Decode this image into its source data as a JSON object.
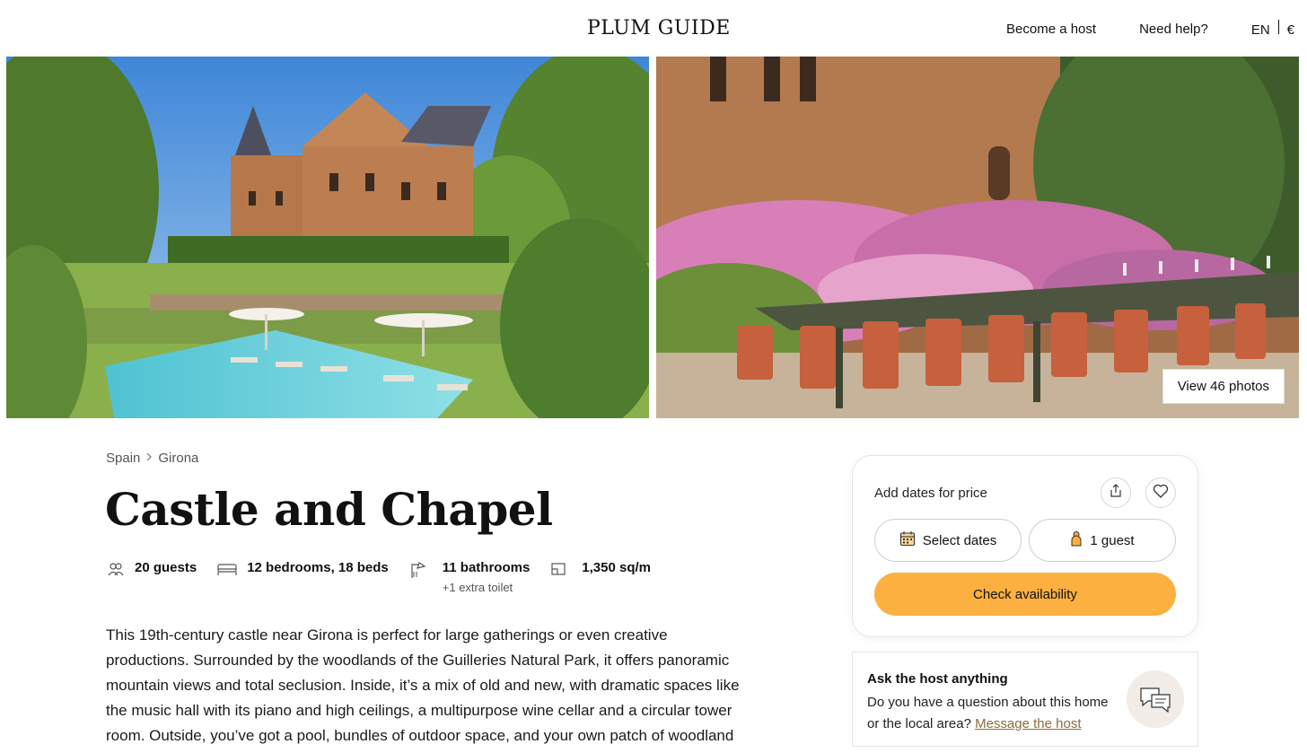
{
  "header": {
    "logo": "PLUM GUIDE",
    "become_host": "Become a host",
    "need_help": "Need help?",
    "language": "EN",
    "currency": "€"
  },
  "gallery": {
    "view_photos": "View 46 photos"
  },
  "breadcrumb": {
    "country": "Spain",
    "city": "Girona"
  },
  "listing": {
    "title": "Castle and Chapel",
    "guests": "20 guests",
    "bedrooms": "12 bedrooms, 18 beds",
    "bathrooms": "11 bathrooms",
    "extra_toilet": "+1 extra toilet",
    "area": "1,350 sq/m",
    "description": "This 19th-century castle near Girona is perfect for large gatherings or even creative productions. Surrounded by the woodlands of the Guilleries Natural Park, it offers panoramic mountain views and total seclusion. Inside, it’s a mix of old and new, with dramatic spaces like the music hall with its piano and high ceilings, a multipurpose wine cellar and a circular tower room. Outside, you’ve got a pool, bundles of outdoor space, and your own patch of woodland"
  },
  "booking": {
    "label": "Add dates for price",
    "select_dates": "Select dates",
    "guests": "1 guest",
    "check_availability": "Check availability",
    "accent_color": "#fbb040"
  },
  "host": {
    "title": "Ask the host anything",
    "question": "Do you have a question about this home or the local area?",
    "link": "Message the host"
  },
  "icons": [
    "share-icon",
    "heart-icon",
    "calendar-icon",
    "person-icon",
    "guests-icon",
    "bed-icon",
    "shower-icon",
    "area-icon",
    "chat-icon",
    "chevron-right-icon"
  ]
}
